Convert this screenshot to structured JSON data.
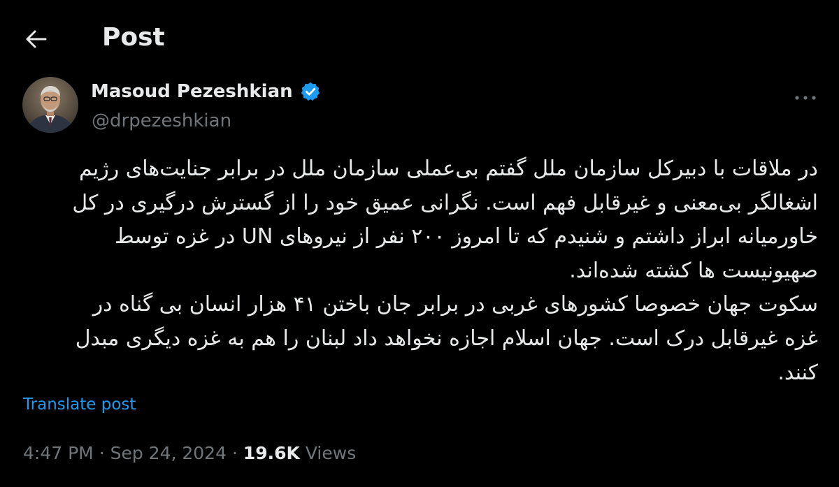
{
  "header": {
    "title": "Post",
    "back_icon": "arrow-left-icon"
  },
  "author": {
    "display_name": "Masoud Pezeshkian",
    "handle": "@drpezeshkian",
    "verified": true,
    "verified_color": "#1d9bf0"
  },
  "post": {
    "lines": [
      "در ملاقات با دبیرکل سازمان ملل گفتم بی‌عملی سازمان ملل در برابر جنایت‌های رژیم",
      "اشغالگر بی‌معنی و غیرقابل فهم است. نگرانی عمیق خود را از گسترش درگیری در کل",
      "خاورمیانه ابراز داشتم و شنیدم که تا امروز ۲۰۰ نفر از نیروهای UN در غزه توسط",
      "صهیونیست ها کشته شده‌اند.",
      "سکوت جهان خصوصا کشورهای غربی در برابر جان باختن ۴۱ هزار انسان بی گناه در",
      "غزه غیرقابل درک است. جهان اسلام اجازه نخواهد داد لبنان را هم به غزه دیگری مبدل",
      "کنند."
    ],
    "translate_label": "Translate post"
  },
  "meta": {
    "time": "4:47 PM",
    "separator": "·",
    "date": "Sep 24, 2024",
    "views_count": "19.6K",
    "views_label": "Views"
  },
  "colors": {
    "background": "#000000",
    "text_primary": "#e7e9ea",
    "text_secondary": "#71767b",
    "link": "#1d9bf0"
  }
}
